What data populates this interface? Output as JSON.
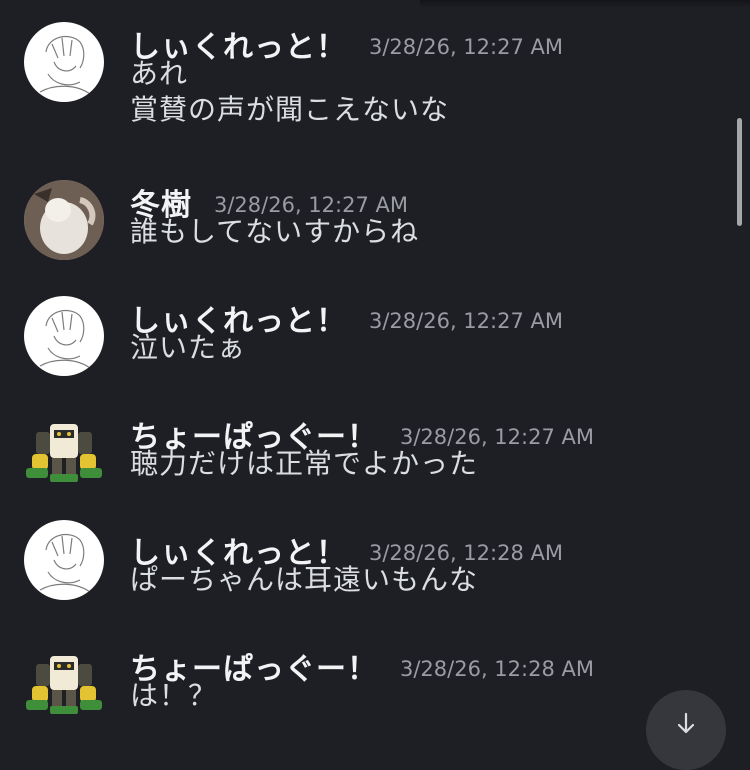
{
  "messages": [
    {
      "username": "しぃくれっと！",
      "timestamp": "3/28/26, 12:27 AM",
      "avatar": "sketch-avatar",
      "lines": [
        "あれ",
        "賞賛の声が聞こえないな"
      ]
    },
    {
      "username": "冬樹",
      "timestamp": "3/28/26, 12:27 AM",
      "avatar": "cat-avatar",
      "lines": [
        "誰もしてないすからね"
      ]
    },
    {
      "username": "しぃくれっと！",
      "timestamp": "3/28/26, 12:27 AM",
      "avatar": "sketch-avatar",
      "lines": [
        "泣いたぁ"
      ]
    },
    {
      "username": "ちょーぱっぐー！",
      "timestamp": "3/28/26, 12:27 AM",
      "avatar": "robot-avatar",
      "lines": [
        "聴力だけは正常でよかった"
      ]
    },
    {
      "username": "しぃくれっと！",
      "timestamp": "3/28/26, 12:28 AM",
      "avatar": "sketch-avatar",
      "lines": [
        "ぱーちゃんは耳遠いもんな"
      ]
    },
    {
      "username": "ちょーぱっぐー！",
      "timestamp": "3/28/26, 12:28 AM",
      "avatar": "robot-avatar",
      "lines": [
        "は！？"
      ]
    }
  ],
  "jump_button": {
    "icon": "arrow-down-icon"
  },
  "colors": {
    "background": "#1e1f24",
    "username": "#f2f3f5",
    "timestamp": "#9a9ca3",
    "message_text": "#dbdee1"
  }
}
